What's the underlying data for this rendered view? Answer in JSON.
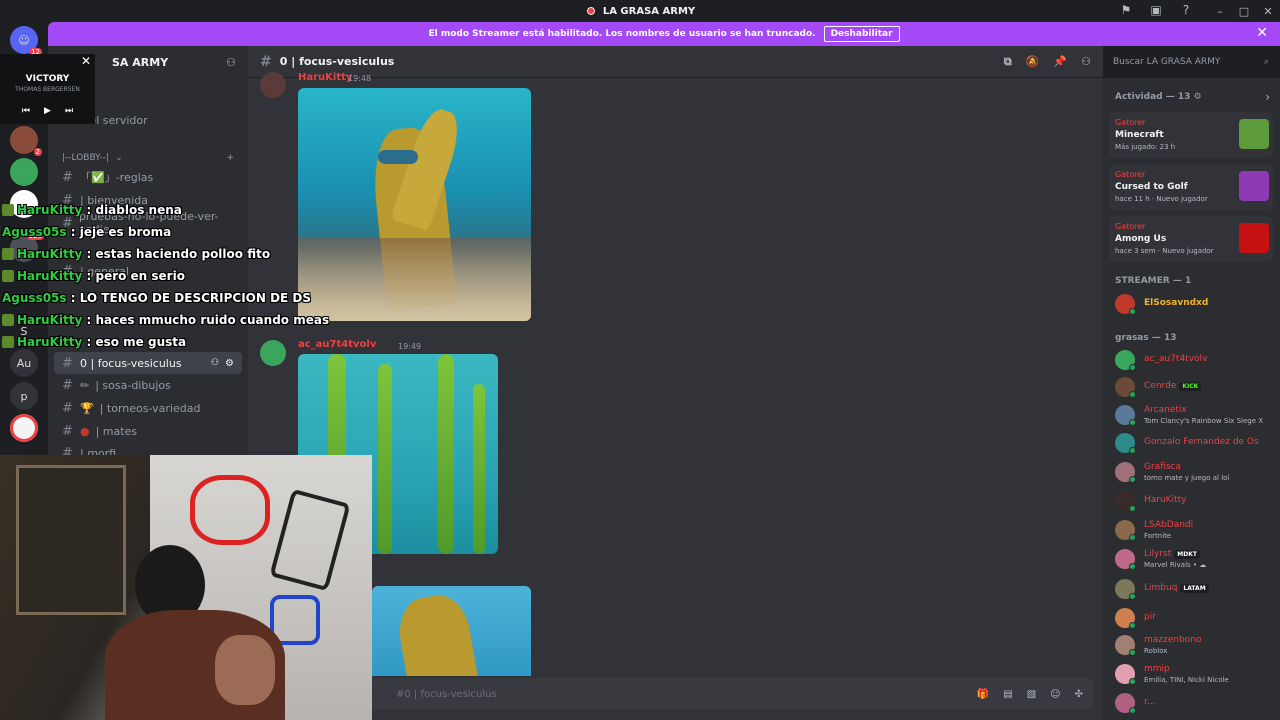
{
  "window": {
    "title": "LA GRASA ARMY",
    "controls": [
      "–",
      "□",
      "✕"
    ]
  },
  "banner": {
    "text": "El modo Streamer está habilitado. Los nombres de usuario se han truncado.",
    "button": "Deshabilitar",
    "close": "✕"
  },
  "guild_rail": {
    "badges": [
      "12",
      "2",
      "126"
    ],
    "letters": [
      "S",
      "Au",
      "p"
    ]
  },
  "server": {
    "name": "SA ARMY",
    "top_items": [
      "tos",
      "ras del servidor"
    ],
    "category": "|--LOBBY--|",
    "channels": [
      {
        "label": "「✅」-reglas"
      },
      {
        "label": "| bienvenida"
      },
      {
        "label": "pruebas-no-lo-puede-ver-nadie"
      },
      {
        "label": "| general"
      },
      {
        "label": "0 | focus-vesiculus",
        "active": true
      },
      {
        "label": "| sosa-dibujos"
      },
      {
        "label": "| torneos-variedad"
      },
      {
        "label": "| mates"
      },
      {
        "label": "| morfi"
      }
    ]
  },
  "channel_header": {
    "name": "0 | focus-vesiculus",
    "search_placeholder": "Buscar LA GRASA ARMY"
  },
  "messages": [
    {
      "author": "HaruKitty",
      "time": "19:48"
    },
    {
      "author": "ac_au7t4tvolv",
      "time": "19:49"
    }
  ],
  "composer": {
    "placeholder": "#0 | focus-vesiculus"
  },
  "right_panel": {
    "activity_header": "Actividad — 13",
    "activities": [
      {
        "user": "Gatorer",
        "game": "Minecraft",
        "meta": "Más jugado: 23 h",
        "thumb_color": "#5d9b3a"
      },
      {
        "user": "Gatorer",
        "game": "Cursed to Golf",
        "meta": "hace 11 h · Nuevo jugador",
        "thumb_color": "#8e3ab5"
      },
      {
        "user": "Gatorer",
        "game": "Among Us",
        "meta": "hace 3 sem · Nuevo jugador",
        "thumb_color": "#c51111"
      }
    ],
    "streamer_header": "STREAMER — 1",
    "streamer": {
      "name": "ElSosavndxd"
    },
    "grasas_header": "grasas — 13",
    "members": [
      {
        "name": "ac_au7t4tvolv",
        "status": "",
        "tag": ""
      },
      {
        "name": "Cenrde",
        "status": "",
        "tag": "KICK"
      },
      {
        "name": "Arcanetix",
        "status": "Tom Clancy's Rainbow Six Siege X",
        "tag": ""
      },
      {
        "name": "Gonzalo Fernandez de Os",
        "status": "",
        "tag": ""
      },
      {
        "name": "Grafisca",
        "status": "tomo mate y juego al lol",
        "tag": ""
      },
      {
        "name": "HaruKitty",
        "status": "",
        "tag": ""
      },
      {
        "name": "LSAbDandi",
        "status": "Fortnite",
        "tag": ""
      },
      {
        "name": "Lilyrst",
        "status": "Marvel Rivals • ☁",
        "tag": "MDKT"
      },
      {
        "name": "Limbuq",
        "status": "",
        "tag": "LATAM"
      },
      {
        "name": "pir",
        "status": "",
        "tag": ""
      },
      {
        "name": "mazzenbono",
        "status": "Roblox",
        "tag": ""
      },
      {
        "name": "mmip",
        "status": "Emilia, TINI, Nicki Nicole",
        "tag": ""
      },
      {
        "name": "r...",
        "status": "",
        "tag": ""
      }
    ]
  },
  "music_player": {
    "title": "VICTORY",
    "artist": "THOMAS BERGERSEN",
    "close": "✕",
    "prev": "⏮",
    "play": "▶",
    "next": "⏭"
  },
  "stream_chat": [
    {
      "user": "HaruKitty",
      "text": ": diablos nena"
    },
    {
      "user": "Aguss05s",
      "text": ": jeje es broma"
    },
    {
      "user": "HaruKitty",
      "text": ": estas haciendo polloo fito"
    },
    {
      "user": "HaruKitty",
      "text": ": pero en serio"
    },
    {
      "user": "Aguss05s",
      "text": ": LO TENGO DE DESCRIPCION DE DS"
    },
    {
      "user": "HaruKitty",
      "text": ": haces mmucho ruido cuando meas"
    },
    {
      "user": "HaruKitty",
      "text": ": eso me gusta"
    }
  ],
  "colors": {
    "accent": "#a349f5",
    "sidebar": "#2b2d31",
    "main": "#313338",
    "rail": "#1e1f22",
    "online": "#23a55a",
    "name_red": "#ed4245",
    "chat_green": "#2ecc40"
  }
}
